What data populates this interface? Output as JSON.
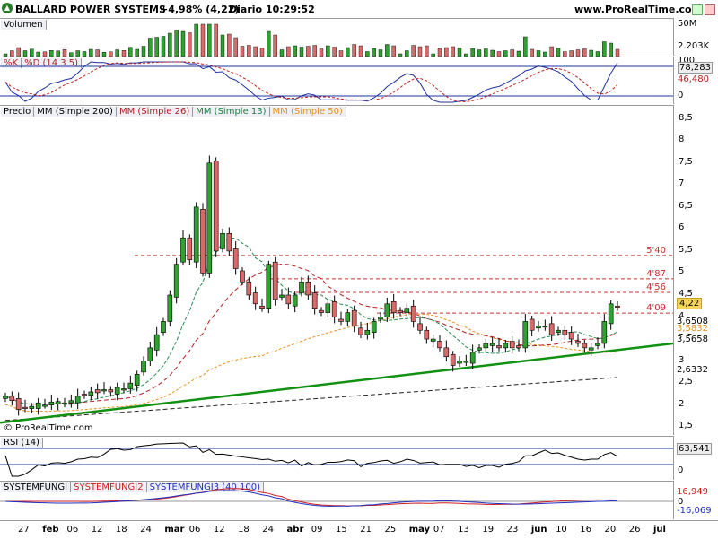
{
  "header": {
    "title": "BALLARD POWER SYSTEMS",
    "change": "+4,98% (4,22)",
    "period": "Diario",
    "time": "10:29:52",
    "site": "www.ProRealTime.com"
  },
  "volume_panel": {
    "label": "Volumen",
    "axis_top": "50M",
    "last_value": "2.203K",
    "axis_bottom": "0"
  },
  "stoch_panel": {
    "label_k": "%K",
    "label_d": "%D (14 3 5)",
    "axis_top": "100",
    "axis_bottom": "0",
    "k_value": "78,283",
    "d_value": "46,480"
  },
  "price_panel": {
    "labels": [
      "Precio",
      "MM (Simple 200)",
      "MM (Simple 26)",
      "MM (Simple 13)",
      "MM (Simple 50)"
    ],
    "label_colors": [
      "#000000",
      "#000000",
      "#b02020",
      "#208040",
      "#e89020"
    ],
    "y_ticks": [
      "8,5",
      "8",
      "7,5",
      "7",
      "6,5",
      "6",
      "5,5",
      "5",
      "4,5",
      "4",
      "3,5",
      "3",
      "2,5",
      "2",
      "1,5"
    ],
    "y_tick_values": [
      8.5,
      8,
      7.5,
      7,
      6.5,
      6,
      5.5,
      5,
      4.5,
      4,
      3.5,
      3,
      2.5,
      2,
      1.5
    ],
    "level_labels": [
      "5'40",
      "4'87",
      "4'56",
      "4'09"
    ],
    "level_values": [
      5.4,
      4.87,
      4.56,
      4.09
    ],
    "last_price": "4,22",
    "ma13_value": "3,6508",
    "ma26_value": "3,5832",
    "ma50_value": "3,5658",
    "ma200_value": "2,6332",
    "watermark": "© ProRealTime.com"
  },
  "rsi_panel": {
    "label": "RSI (14)",
    "value": "63,541",
    "axis_bottom": "0"
  },
  "fungi_panel": {
    "labels": [
      "SYSTEMFUNGI",
      "SYSTEMFUNGI2",
      "SYSTEMFUNGI3 (40 100)"
    ],
    "label_colors": [
      "#000000",
      "#d02020",
      "#2030c0"
    ],
    "value_red": "16,949",
    "value_blue": "-16,069",
    "axis_zero": "0"
  },
  "x_axis": [
    "27",
    "feb",
    "06",
    "12",
    "18",
    "24",
    "mar",
    "06",
    "12",
    "18",
    "24",
    "abr",
    "09",
    "15",
    "21",
    "25",
    "may",
    "07",
    "13",
    "19",
    "23",
    "jun",
    "10",
    "16",
    "20",
    "26",
    "jul"
  ],
  "colors": {
    "up": "#2ea12e",
    "down": "#d86a6a",
    "trend": "#129012",
    "ma13": "#2a8a55",
    "ma26": "#b02020",
    "ma50": "#e89020",
    "ma200": "#222222"
  },
  "chart_data": {
    "type": "candlestick",
    "title": "BALLARD POWER SYSTEMS",
    "ylim": [
      1.3,
      8.8
    ],
    "closes": [
      2.2,
      2.1,
      1.9,
      1.92,
      1.97,
      2.05,
      2.0,
      2.07,
      2.08,
      2.05,
      2.1,
      2.2,
      2.22,
      2.3,
      2.28,
      2.35,
      2.3,
      2.4,
      2.37,
      2.5,
      2.7,
      3.0,
      3.3,
      3.6,
      3.9,
      4.5,
      5.2,
      5.8,
      5.3,
      6.5,
      5.0,
      7.5,
      5.5,
      5.9,
      5.5,
      5.1,
      4.8,
      4.5,
      4.3,
      4.2,
      5.2,
      4.4,
      4.5,
      4.3,
      4.5,
      4.8,
      4.5,
      4.2,
      4.1,
      4.3,
      4.0,
      3.9,
      4.1,
      3.8,
      3.6,
      3.7,
      3.9,
      4.0,
      4.3,
      4.1,
      4.1,
      4.2,
      3.9,
      3.7,
      3.5,
      3.5,
      3.3,
      3.1,
      2.9,
      3.0,
      3.0,
      3.2,
      3.3,
      3.4,
      3.4,
      3.3,
      3.4,
      3.3,
      3.3,
      3.9,
      3.7,
      3.8,
      3.8,
      3.6,
      3.7,
      3.6,
      3.5,
      3.4,
      3.3,
      3.3,
      3.4,
      3.9,
      4.3,
      4.22
    ],
    "volume_last": 2203
  }
}
